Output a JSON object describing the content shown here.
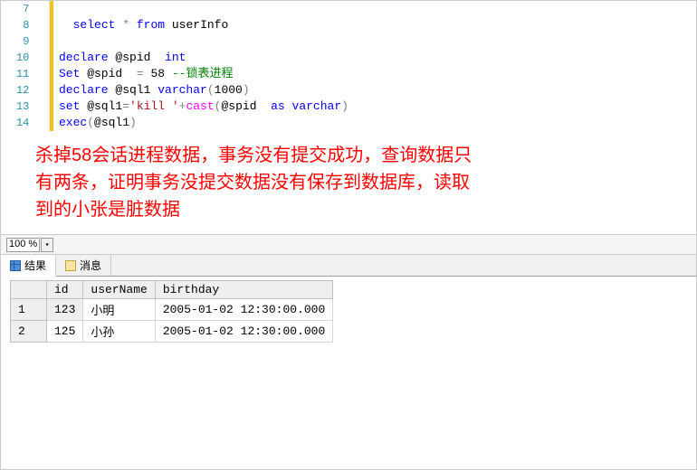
{
  "editor": {
    "lines": [
      {
        "num": "7",
        "tokens": []
      },
      {
        "num": "8",
        "tokens": [
          {
            "t": "  ",
            "c": "black"
          },
          {
            "t": "select",
            "c": "kw"
          },
          {
            "t": " ",
            "c": "black"
          },
          {
            "t": "*",
            "c": "gray"
          },
          {
            "t": " ",
            "c": "black"
          },
          {
            "t": "from",
            "c": "kw"
          },
          {
            "t": " userInfo",
            "c": "black"
          }
        ]
      },
      {
        "num": "9",
        "tokens": []
      },
      {
        "num": "10",
        "tokens": [
          {
            "t": "declare",
            "c": "kw"
          },
          {
            "t": " @spid  ",
            "c": "black"
          },
          {
            "t": "int",
            "c": "kw"
          }
        ]
      },
      {
        "num": "11",
        "tokens": [
          {
            "t": "Set",
            "c": "kw"
          },
          {
            "t": " @spid  ",
            "c": "black"
          },
          {
            "t": "=",
            "c": "gray"
          },
          {
            "t": " 58 ",
            "c": "black"
          },
          {
            "t": "--锁表进程",
            "c": "comment"
          }
        ]
      },
      {
        "num": "12",
        "tokens": [
          {
            "t": "declare",
            "c": "kw"
          },
          {
            "t": " @sql1 ",
            "c": "black"
          },
          {
            "t": "varchar",
            "c": "kw"
          },
          {
            "t": "(",
            "c": "gray"
          },
          {
            "t": "1000",
            "c": "black"
          },
          {
            "t": ")",
            "c": "gray"
          }
        ]
      },
      {
        "num": "13",
        "tokens": [
          {
            "t": "set",
            "c": "kw"
          },
          {
            "t": " @sql1",
            "c": "black"
          },
          {
            "t": "=",
            "c": "gray"
          },
          {
            "t": "'kill '",
            "c": "str"
          },
          {
            "t": "+",
            "c": "gray"
          },
          {
            "t": "cast",
            "c": "func"
          },
          {
            "t": "(",
            "c": "gray"
          },
          {
            "t": "@spid  ",
            "c": "black"
          },
          {
            "t": "as",
            "c": "kw"
          },
          {
            "t": " ",
            "c": "black"
          },
          {
            "t": "varchar",
            "c": "kw"
          },
          {
            "t": ")",
            "c": "gray"
          }
        ]
      },
      {
        "num": "14",
        "tokens": [
          {
            "t": "exec",
            "c": "kw"
          },
          {
            "t": "(",
            "c": "gray"
          },
          {
            "t": "@sql1",
            "c": "black"
          },
          {
            "t": ")",
            "c": "gray"
          }
        ]
      }
    ]
  },
  "annotation": {
    "line1": "杀掉58会话进程数据，事务没有提交成功，查询数据只",
    "line2": "有两条，证明事务没提交数据没有保存到数据库，读取",
    "line3": "到的小张是脏数据"
  },
  "zoom": {
    "value": "100 %"
  },
  "tabs": {
    "results": "结果",
    "messages": "消息"
  },
  "results": {
    "headers": [
      "",
      "id",
      "userName",
      "birthday"
    ],
    "rows": [
      {
        "idx": "1",
        "id": "123",
        "userName": "小明",
        "birthday": "2005-01-02 12:30:00.000"
      },
      {
        "idx": "2",
        "id": "125",
        "userName": "小孙",
        "birthday": "2005-01-02 12:30:00.000"
      }
    ]
  }
}
